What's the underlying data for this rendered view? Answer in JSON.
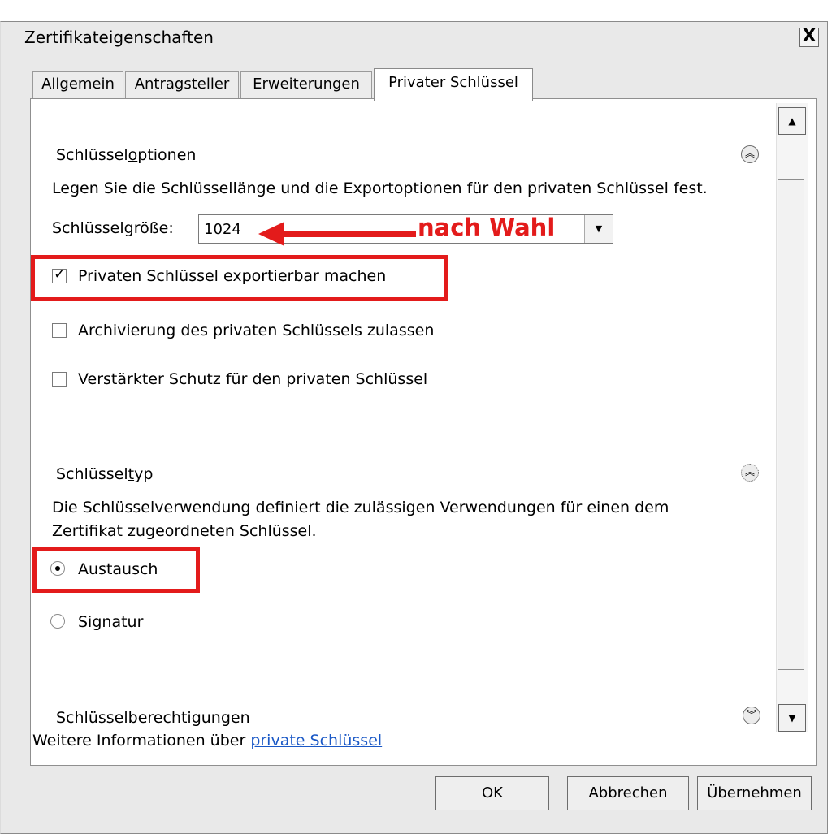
{
  "window": {
    "title": "Zertifikateigenschaften",
    "close_label": "X"
  },
  "tabs": [
    {
      "label": "Allgemein",
      "active": false
    },
    {
      "label": "Antragsteller",
      "active": false
    },
    {
      "label": "Erweiterungen",
      "active": false
    },
    {
      "label": "Privater Schlüssel",
      "active": true
    }
  ],
  "key_options": {
    "heading_prefix": "Schlüssel",
    "heading_underlined": "o",
    "heading_suffix": "ptionen",
    "description": "Legen Sie die Schlüssellänge und die Exportoptionen für den privaten Schlüssel fest.",
    "size_label": "Schlüsselgröße:",
    "size_value": "1024",
    "annotation": "nach Wahl",
    "export_label": "Privaten Schlüssel exportierbar machen",
    "export_checked": true,
    "archive_label": "Archivierung des privaten Schlüssels zulassen",
    "archive_checked": false,
    "protection_label": "Verstärkter Schutz für den privaten Schlüssel",
    "protection_checked": false
  },
  "key_type": {
    "heading_prefix": "Schlüssel",
    "heading_underlined": "t",
    "heading_suffix": "yp",
    "description_line1": "Die Schlüsselverwendung definiert die zulässigen Verwendungen für einen dem",
    "description_line2": "Zertifikat zugeordneten Schlüssel.",
    "exchange_label": "Austausch",
    "exchange_selected": true,
    "signature_label": "Signatur",
    "signature_selected": false
  },
  "permissions": {
    "heading_prefix": "Schlüssel",
    "heading_underlined": "b",
    "heading_suffix": "erechtigungen",
    "info_prefix": "Weitere Informationen über",
    "info_link": "private Schlüssel"
  },
  "buttons": {
    "ok": "OK",
    "cancel": "Abbrechen",
    "apply": "Übernehmen"
  },
  "colors": {
    "highlight_red": "#e31b1b",
    "link_blue": "#1a58c6"
  }
}
